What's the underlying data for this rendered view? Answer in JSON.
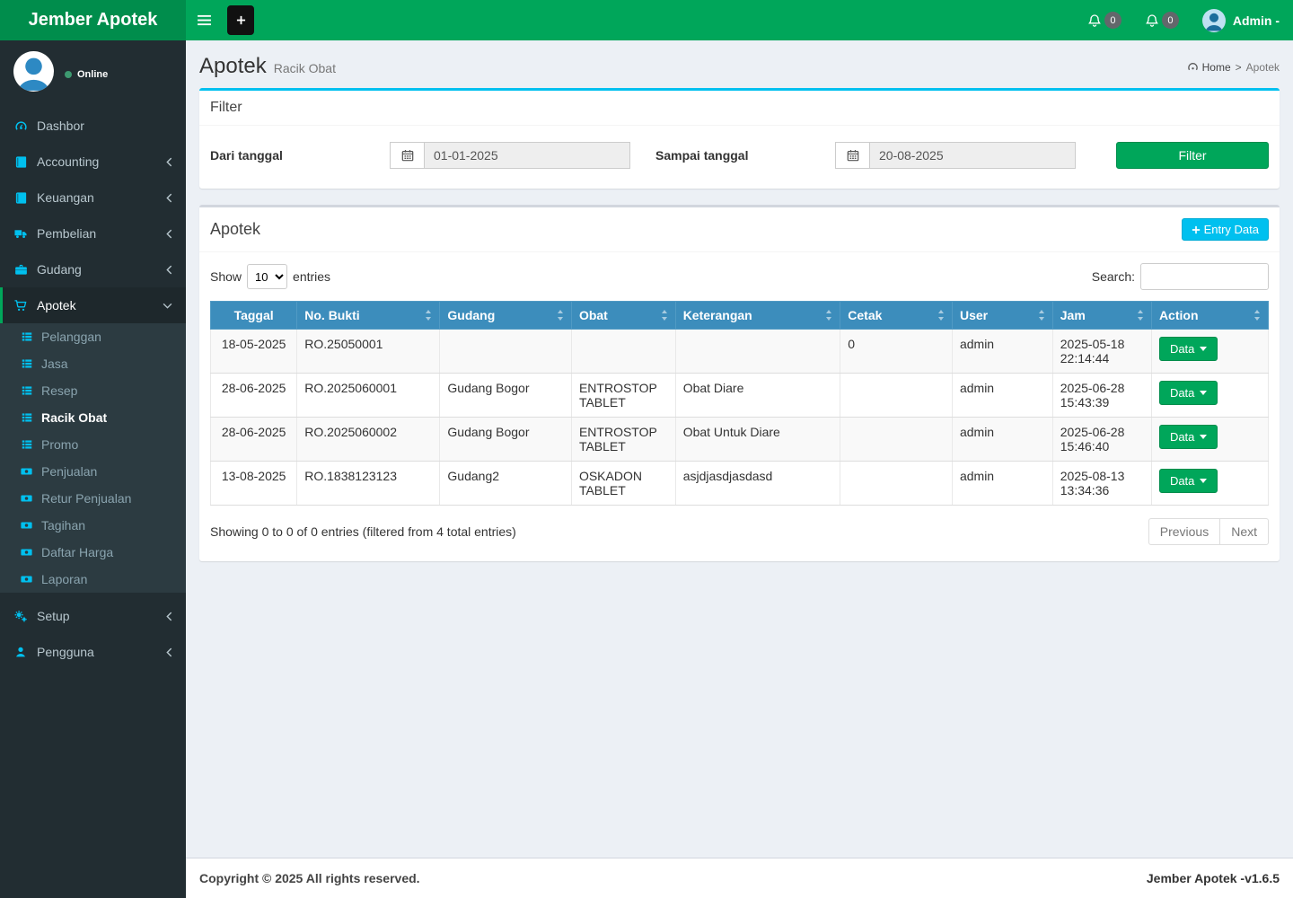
{
  "header": {
    "brand": "Jember Apotek",
    "notifications": [
      {
        "count": "0"
      },
      {
        "count": "0"
      }
    ],
    "user_label": "Admin -"
  },
  "sidebar": {
    "status": "Online",
    "items": [
      {
        "label": "Dashbor"
      },
      {
        "label": "Accounting"
      },
      {
        "label": "Keuangan"
      },
      {
        "label": "Pembelian"
      },
      {
        "label": "Gudang"
      },
      {
        "label": "Apotek"
      },
      {
        "label": "Setup"
      },
      {
        "label": "Pengguna"
      }
    ],
    "apotek_children": [
      {
        "label": "Pelanggan"
      },
      {
        "label": "Jasa"
      },
      {
        "label": "Resep"
      },
      {
        "label": "Racik Obat"
      },
      {
        "label": "Promo"
      },
      {
        "label": "Penjualan"
      },
      {
        "label": "Retur Penjualan"
      },
      {
        "label": "Tagihan"
      },
      {
        "label": "Daftar Harga"
      },
      {
        "label": "Laporan"
      }
    ]
  },
  "page": {
    "title": "Apotek",
    "subtitle": "Racik Obat",
    "breadcrumb": {
      "home": "Home",
      "sep": ">",
      "current": "Apotek"
    }
  },
  "filter": {
    "box_title": "Filter",
    "from_label": "Dari tanggal",
    "from_value": "01-01-2025",
    "to_label": "Sampai tanggal",
    "to_value": "20-08-2025",
    "button": "Filter"
  },
  "table_box": {
    "title": "Apotek",
    "entry_button": "Entry Data",
    "show_label": "Show",
    "entries_label": "entries",
    "page_length": "10",
    "search_label": "Search:",
    "columns": [
      "Taggal",
      "No. Bukti",
      "Gudang",
      "Obat",
      "Keterangan",
      "Cetak",
      "User",
      "Jam",
      "Action"
    ],
    "rows": [
      {
        "tanggal": "18-05-2025",
        "no_bukti": "RO.25050001",
        "gudang": "",
        "obat": "",
        "keterangan": "",
        "cetak": "0",
        "user": "admin",
        "jam": "2025-05-18 22:14:44",
        "action": "Data"
      },
      {
        "tanggal": "28-06-2025",
        "no_bukti": "RO.2025060001",
        "gudang": "Gudang Bogor",
        "obat": "ENTROSTOP TABLET",
        "keterangan": "Obat Diare",
        "cetak": "",
        "user": "admin",
        "jam": "2025-06-28 15:43:39",
        "action": "Data"
      },
      {
        "tanggal": "28-06-2025",
        "no_bukti": "RO.2025060002",
        "gudang": "Gudang Bogor",
        "obat": "ENTROSTOP TABLET",
        "keterangan": "Obat Untuk Diare",
        "cetak": "",
        "user": "admin",
        "jam": "2025-06-28 15:46:40",
        "action": "Data"
      },
      {
        "tanggal": "13-08-2025",
        "no_bukti": "RO.1838123123",
        "gudang": "Gudang2",
        "obat": "OSKADON TABLET",
        "keterangan": "asjdjasdjasdasd",
        "cetak": "",
        "user": "admin",
        "jam": "2025-08-13 13:34:36",
        "action": "Data"
      }
    ],
    "info": "Showing 0 to 0 of 0 entries (filtered from 4 total entries)",
    "previous": "Previous",
    "next": "Next"
  },
  "footer": {
    "copyright": "Copyright © 2025 All rights reserved.",
    "version": "Jember Apotek -v1.6.5"
  }
}
